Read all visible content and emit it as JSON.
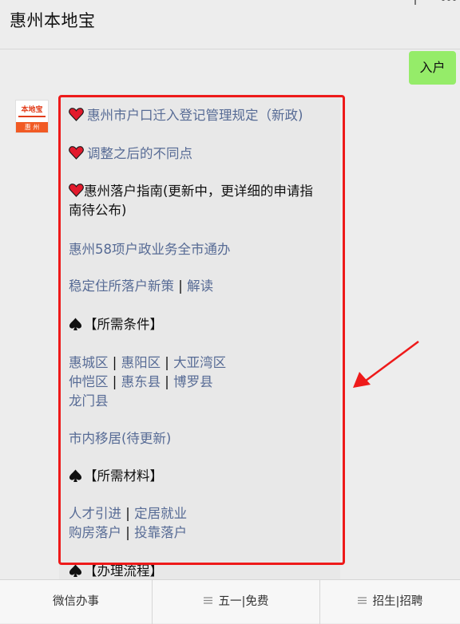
{
  "header": {
    "title": "惠州本地宝"
  },
  "user_message": {
    "text": "入户"
  },
  "avatar": {
    "brand_top": "本地宝",
    "brand_bottom": "惠 州"
  },
  "reply": {
    "line1": "惠州市户口迁入登记管理规定（新政)",
    "line2": "调整之后的不同点",
    "line3a": "惠州落户指南(更新中，更详细的申请指",
    "line3b": "南待公布)",
    "line4": "惠州58项户政业务全市通办",
    "line5a": "稳定住所落户新策",
    "line5sep": " | ",
    "line5b": "解读",
    "section1": "【所需条件】",
    "cond_a1": "惠城区",
    "cond_a2": "惠阳区",
    "cond_a3": "大亚湾区",
    "cond_b1": "仲恺区",
    "cond_b2": "惠东县",
    "cond_b3": "博罗县",
    "cond_c1": "龙门县",
    "sep": " | ",
    "line_move": "市内移居(待更新)",
    "section2": "【所需材料】",
    "mat_a1": "人才引进",
    "mat_a2": "定居就业",
    "mat_b1": "购房落户",
    "mat_b2": "投靠落户",
    "section3": "【办理流程】"
  },
  "tabbar": {
    "tab1": "微信办事",
    "tab2": "五一|免费",
    "tab3": "招生|招聘"
  },
  "colors": {
    "link": "#576b95",
    "highlight": "#ee1a1a",
    "bubble_user": "#95ec69"
  }
}
